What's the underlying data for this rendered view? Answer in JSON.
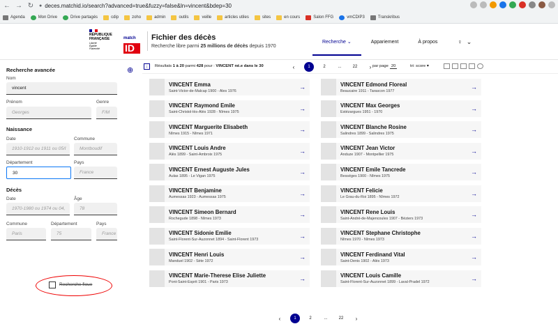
{
  "browser": {
    "url": "deces.matchid.io/search?advanced=true&fuzzy=false&ln=vincent&bdep=30",
    "bookmarks": [
      "Agenda",
      "Mon Drive",
      "Drive partagés",
      "cdip",
      "zoho",
      "admin",
      "outils",
      "veille",
      "articles utiles",
      "sites",
      "en cours",
      "Salon FFG",
      "vmCDIP3",
      "Transkribus"
    ]
  },
  "header": {
    "rf_line1": "RÉPUBLIQUE",
    "rf_line2": "FRANÇAISE",
    "motto1": "Liberté",
    "motto2": "Égalité",
    "motto3": "Fraternité",
    "logo_top": "match",
    "logo_id": "ID",
    "title": "Fichier des décès",
    "subtitle_pre": "Recherche libre parmi",
    "subtitle_bold": "25 millions de décès",
    "subtitle_post": "depuis 1970",
    "nav": [
      "Recherche",
      "Appariement",
      "À propos"
    ]
  },
  "search": {
    "title": "Recherche avancée",
    "nom_label": "Nom",
    "nom_value": "vincent",
    "prenom_label": "Prénom",
    "prenom_placeholder": "Georges",
    "genre_label": "Genre",
    "genre_placeholder": "F/M",
    "naissance_title": "Naissance",
    "date_label": "Date",
    "naissance_date_placeholder": "1910-1912 ou 1911 ou 05/I",
    "commune_label": "Commune",
    "naissance_commune_placeholder": "Montboudif",
    "departement_label": "Département",
    "naissance_departement_value": "30",
    "pays_label": "Pays",
    "pays_placeholder": "France",
    "deces_title": "Décès",
    "deces_date_placeholder": "1970-1980 ou 1974 ou 04,",
    "age_label": "Âge",
    "age_placeholder": "78",
    "deces_commune_placeholder": "Paris",
    "deces_departement_placeholder": "75",
    "fuzzy_label": "Recherche floue"
  },
  "results": {
    "summary_pre": "Résultats",
    "summary_range": "1 à 20",
    "summary_mid": "parmi",
    "summary_total": "428",
    "summary_post": "pour :",
    "summary_query": "VINCENT né.e dans le 30",
    "pages": [
      "1",
      "2",
      "...",
      "22"
    ],
    "perpage_label": "par page",
    "perpage_value": "20",
    "sort_label": "tri: score",
    "items": [
      {
        "name": "VINCENT Emma",
        "details": "Saint-Victor-de-Malcap 1900 - Ales 1976"
      },
      {
        "name": "VINCENT Edmond Floreal",
        "details": "Beaucaire 1911 - Tarascon 1977"
      },
      {
        "name": "VINCENT Raymond Emile",
        "details": "Saint-Christol-lès-Alès 1928 - Nîmes 1975"
      },
      {
        "name": "VINCENT Max Georges",
        "details": "Estézargues 1951 - 1970"
      },
      {
        "name": "VINCENT Marguerite Elisabeth",
        "details": "Nîmes 1915 - Nîmes 1971"
      },
      {
        "name": "VINCENT Blanche Rosine",
        "details": "Salindres 1899 - Salindres 1975"
      },
      {
        "name": "VINCENT Louis Andre",
        "details": "Alès 1899 - Saint-Ambroix 1975"
      },
      {
        "name": "VINCENT Jean Victor",
        "details": "Anduze 1907 - Montpellier 1975"
      },
      {
        "name": "VINCENT Ernest Auguste Jules",
        "details": "Aulas 1895 - Le Vigan 1975"
      },
      {
        "name": "VINCENT Emile Tancrede",
        "details": "Bességes 1900 - Nîmes 1975"
      },
      {
        "name": "VINCENT Benjamine",
        "details": "Aumessas 1923 - Aumessas 1975"
      },
      {
        "name": "VINCENT Felicie",
        "details": "Le Grau-du-Roi 1895 - Nîmes 1972"
      },
      {
        "name": "VINCENT Simeon Bernard",
        "details": "Rochegude 1898 - Nîmes 1973"
      },
      {
        "name": "VINCENT Rene Louis",
        "details": "Saint-André-de-Majencoules 1907 - Béziers 1973"
      },
      {
        "name": "VINCENT Sidonie Emilie",
        "details": "Saint-Florent-Sur-Auzonnet 1894 - Saint-Florent 1973"
      },
      {
        "name": "VINCENT Stephane Christophe",
        "details": "Nîmes 1970 - Nîmes 1973"
      },
      {
        "name": "VINCENT Henri Louis",
        "details": "Manduel 1902 - Sète 1972"
      },
      {
        "name": "VINCENT Ferdinand Vital",
        "details": "Saint-Denis 1902 - Alès 1973"
      },
      {
        "name": "VINCENT Marie-Therese Elise Juliette",
        "details": "Pont-Saint-Esprit 1901 - Paris 1973"
      },
      {
        "name": "VINCENT Louis Camille",
        "details": "Saint-Florent-Sur-Auzonnet 1899 - Laval-Pradel 1972"
      }
    ]
  },
  "icons": {
    "back": "←",
    "forward": "→",
    "reload": "↻",
    "lock": "🔒",
    "zoom": "⊕",
    "user": "♀",
    "chevron": "⌄",
    "arrow": "→",
    "prev": "‹",
    "next": "›"
  },
  "colors": {
    "accent": "#000091",
    "marianne_red": "#e1000f",
    "focus": "#0a76f6",
    "annotation": "#e00000"
  }
}
